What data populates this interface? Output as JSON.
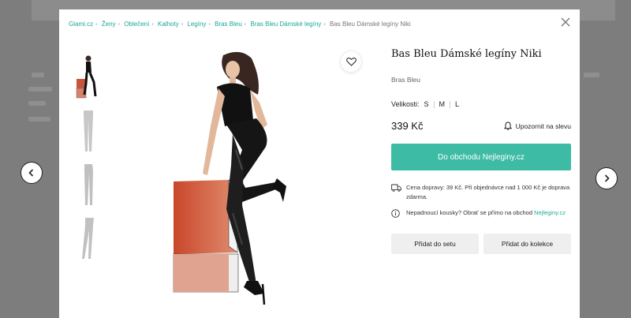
{
  "breadcrumb": {
    "items": [
      "Glami.cz",
      "Ženy",
      "Oblečení",
      "Kalhoty",
      "Legíny",
      "Bras Bleu",
      "Bras Bleu Dámské legíny"
    ],
    "current": "Bas Bleu Dámské legíny Niki"
  },
  "product": {
    "title": "Bas Bleu Dámské legíny Niki",
    "brand": "Bras Bleu",
    "sizes_label": "Velikosti:",
    "sizes": [
      "S",
      "M",
      "L"
    ],
    "price": "339 Kč",
    "notify_label": "Upozornit na slevu",
    "shop_button": "Do obchodu Nejleginy.cz",
    "shipping_note": "Cena dopravy: 39 Kč. Při objednávce nad 1 000 Kč je doprava zdarma.",
    "fit_note": "Nepadnoucí kousky? Obrať se přímo na obchod",
    "fit_note_link": "Nejleginy.cz",
    "add_to_set": "Přidat do setu",
    "add_to_collection": "Přidat do kolekce"
  },
  "icons": {
    "close": "close-icon",
    "favorite": "heart-icon",
    "bell": "bell-icon",
    "truck": "truck-icon",
    "info": "info-icon",
    "prev": "chevron-left-icon",
    "next": "chevron-right-icon"
  },
  "colors": {
    "accent": "#3dbba5",
    "link": "#1aaa96"
  }
}
